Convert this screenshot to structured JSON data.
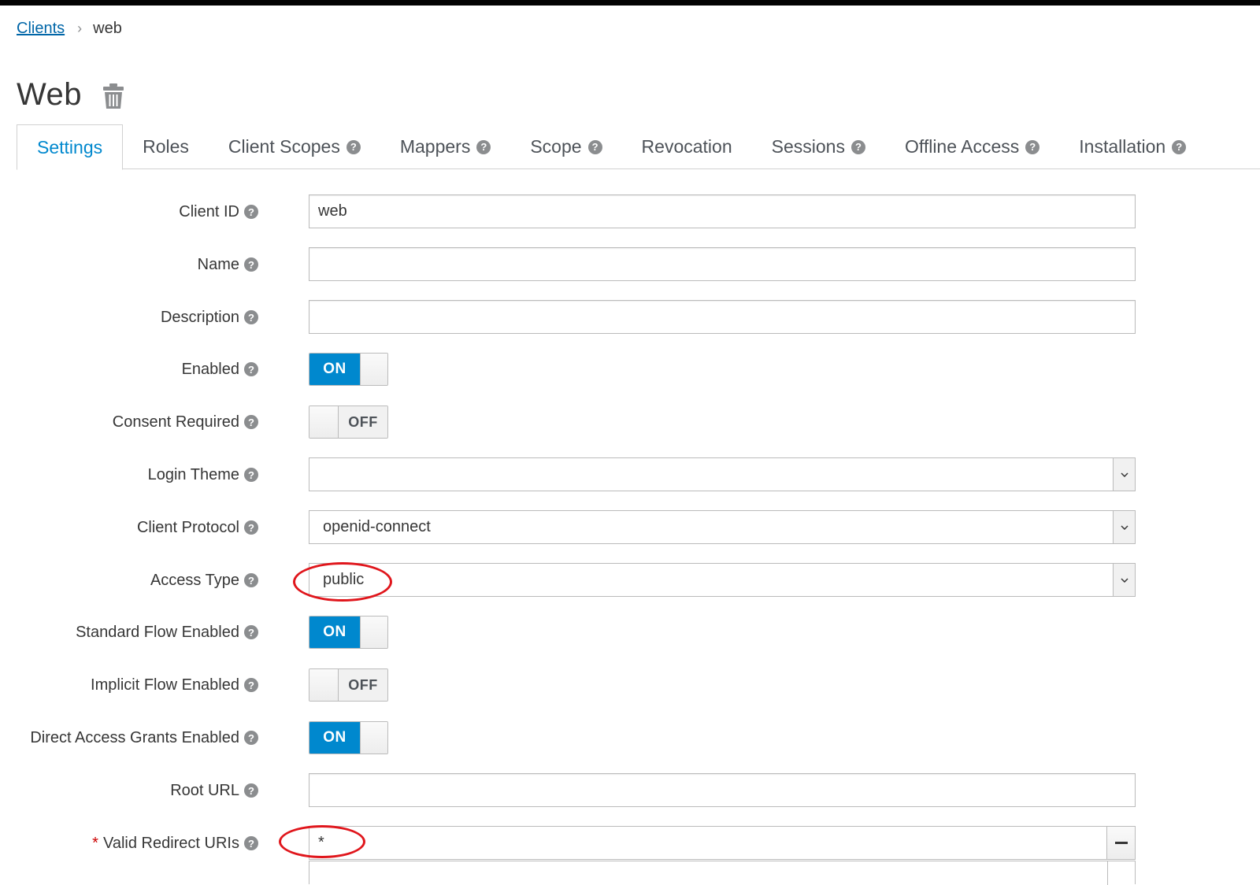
{
  "breadcrumb": {
    "link": "Clients",
    "separator": "›",
    "current": "web"
  },
  "page": {
    "title": "Web"
  },
  "tabs": [
    {
      "label": "Settings",
      "help": false
    },
    {
      "label": "Roles",
      "help": false
    },
    {
      "label": "Client Scopes",
      "help": true
    },
    {
      "label": "Mappers",
      "help": true
    },
    {
      "label": "Scope",
      "help": true
    },
    {
      "label": "Revocation",
      "help": false
    },
    {
      "label": "Sessions",
      "help": true
    },
    {
      "label": "Offline Access",
      "help": true
    },
    {
      "label": "Installation",
      "help": true
    }
  ],
  "help_glyph": "?",
  "form": {
    "client_id": {
      "label": "Client ID",
      "value": "web"
    },
    "name": {
      "label": "Name",
      "value": ""
    },
    "description": {
      "label": "Description",
      "value": ""
    },
    "enabled": {
      "label": "Enabled",
      "state": "ON"
    },
    "consent_required": {
      "label": "Consent Required",
      "state": "OFF"
    },
    "login_theme": {
      "label": "Login Theme",
      "value": ""
    },
    "client_protocol": {
      "label": "Client Protocol",
      "value": "openid-connect"
    },
    "access_type": {
      "label": "Access Type",
      "value": "public"
    },
    "standard_flow": {
      "label": "Standard Flow Enabled",
      "state": "ON"
    },
    "implicit_flow": {
      "label": "Implicit Flow Enabled",
      "state": "OFF"
    },
    "direct_access": {
      "label": "Direct Access Grants Enabled",
      "state": "ON"
    },
    "root_url": {
      "label": "Root URL",
      "value": ""
    },
    "valid_redirect_uris": {
      "label": "Valid Redirect URIs",
      "required_mark": "*",
      "value": "*"
    }
  },
  "colors": {
    "accent": "#0088ce",
    "link": "#0066a8",
    "annotation": "#e0161c",
    "required": "#cc0000"
  }
}
